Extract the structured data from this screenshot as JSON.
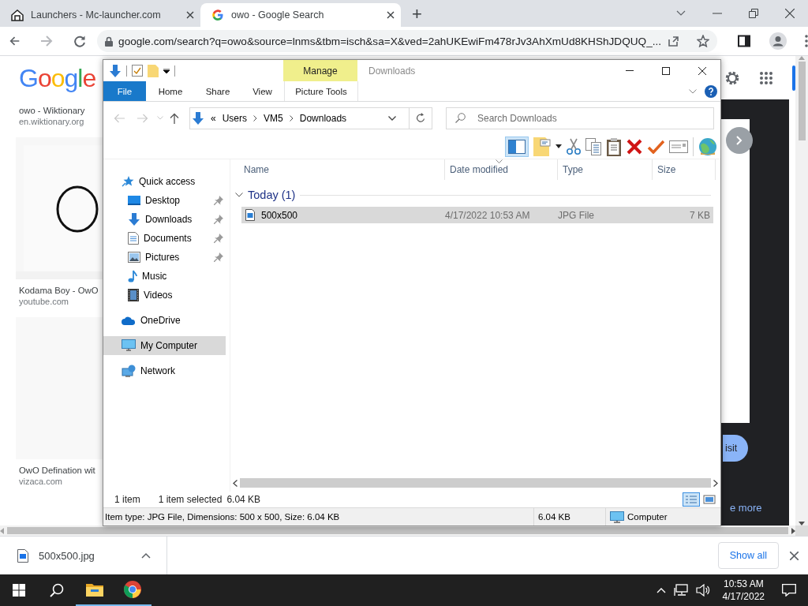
{
  "browser": {
    "tabs": [
      {
        "title": "Launchers - Mc-launcher.com",
        "selected": false,
        "kind": "site"
      },
      {
        "title": "owo - Google Search",
        "selected": true,
        "kind": "google"
      }
    ],
    "new_tab": "+",
    "address": "google.com/search?q=owo&source=lnms&tbm=isch&sa=X&ved=2ahUKEwiFm478rJv3AhXmUd8KHShJDQUQ_..."
  },
  "page": {
    "logo": "Google",
    "items": [
      {
        "kind": "caption",
        "title": "owo - Wiktionary",
        "site": "en.wiktionary.org"
      },
      {
        "kind": "picture"
      },
      {
        "kind": "caption",
        "title": "Kodama Boy - OwO",
        "site": "youtube.com"
      },
      {
        "kind": "blank"
      },
      {
        "kind": "caption",
        "title": "OwO Defination wit",
        "site": "vizaca.com"
      }
    ],
    "visit_button": "isit",
    "more_link": "e more"
  },
  "explorer": {
    "title": "Downloads",
    "context_group": "Manage",
    "ribbon_tabs": [
      {
        "label": "File",
        "kind": "file"
      },
      {
        "label": "Home",
        "kind": "tab"
      },
      {
        "label": "Share",
        "kind": "tab"
      },
      {
        "label": "View",
        "kind": "tab"
      },
      {
        "label": "Picture Tools",
        "kind": "context"
      }
    ],
    "breadcrumb_overflow": "«",
    "breadcrumb": [
      "Users",
      "VM5",
      "Downloads"
    ],
    "search": {
      "placeholder": "Search Downloads"
    },
    "preview_pane_on": true,
    "nav": [
      {
        "label": "Quick access",
        "kind": "star",
        "pinned": false,
        "selected": false,
        "children": [
          {
            "label": "Desktop",
            "kind": "desktop",
            "pinned": true,
            "selected": false
          },
          {
            "label": "Downloads",
            "kind": "downloads",
            "pinned": true,
            "selected": false
          },
          {
            "label": "Documents",
            "kind": "documents",
            "pinned": true,
            "selected": false
          },
          {
            "label": "Pictures",
            "kind": "pictures",
            "pinned": true,
            "selected": false
          },
          {
            "label": "Music",
            "kind": "music",
            "pinned": false,
            "selected": false
          },
          {
            "label": "Videos",
            "kind": "videos",
            "pinned": false,
            "selected": false
          }
        ]
      },
      {
        "label": "OneDrive",
        "kind": "cloud",
        "pinned": false,
        "selected": false
      },
      {
        "label": "My Computer",
        "kind": "computer",
        "pinned": false,
        "selected": true
      },
      {
        "label": "Network",
        "kind": "network",
        "pinned": false,
        "selected": false
      }
    ],
    "columns": [
      "Name",
      "Date modified",
      "Type",
      "Size"
    ],
    "group": "Today (1)",
    "files": [
      {
        "name": "500x500",
        "date": "4/17/2022 10:53 AM",
        "type": "JPG File",
        "size": "7 KB",
        "selected": true
      }
    ],
    "status": {
      "count": "1 item",
      "selection": "1 item selected",
      "size": "6.04 KB"
    },
    "details": {
      "info": "Item type: JPG File, Dimensions: 500 x 500, Size: 6.04 KB",
      "size": "6.04 KB",
      "location": "Computer"
    }
  },
  "downloads": {
    "file": "500x500.jpg",
    "show_all": "Show all"
  },
  "taskbar": {
    "time": "10:53 AM",
    "date": "4/17/2022"
  }
}
